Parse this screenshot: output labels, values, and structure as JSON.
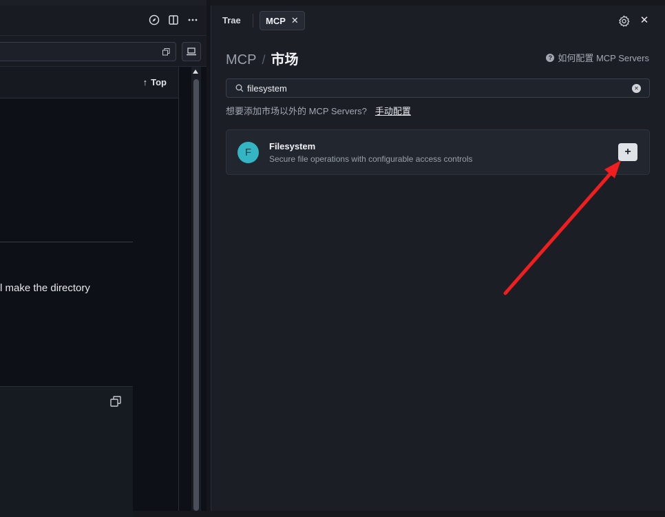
{
  "left_panel": {
    "top_link_label": "Top",
    "page_text": "l make the directory"
  },
  "mcp_panel": {
    "tabs": [
      {
        "label": "Trae",
        "active": false
      },
      {
        "label": "MCP",
        "active": true
      }
    ],
    "breadcrumb": {
      "root": "MCP",
      "separator": "/",
      "current": "市场"
    },
    "help_link": "如何配置 MCP Servers",
    "search": {
      "value": "filesystem"
    },
    "hint": {
      "text": "想要添加市场以外的 MCP Servers?",
      "link": "手动配置"
    },
    "server_card": {
      "avatar_letter": "F",
      "name": "Filesystem",
      "description": "Secure file operations with configurable access controls",
      "add_label": "+"
    }
  },
  "colors": {
    "accent_avatar": "#34b5c4",
    "annotation_arrow": "#f01e1e"
  }
}
